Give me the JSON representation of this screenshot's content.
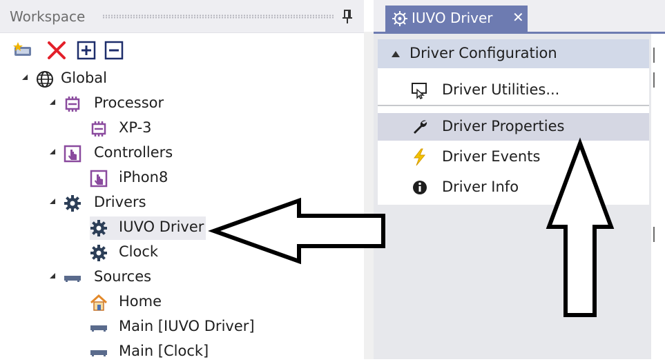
{
  "workspace": {
    "title": "Workspace",
    "pin_icon": "pin-icon",
    "toolbar": [
      {
        "name": "add-item-button",
        "icon": "add-item-icon"
      },
      {
        "name": "delete-button",
        "icon": "red-x-icon"
      },
      {
        "name": "expand-all-button",
        "icon": "plus-box-icon"
      },
      {
        "name": "collapse-all-button",
        "icon": "minus-box-icon"
      }
    ],
    "tree": {
      "global": "Global",
      "processor": "Processor",
      "processor_child": "XP-3",
      "controllers": "Controllers",
      "controller_child": "iPhon8",
      "drivers": "Drivers",
      "driver_1": "IUVO Driver",
      "driver_2": "Clock",
      "sources": "Sources",
      "source_1": "Home",
      "source_2": "Main [IUVO Driver]",
      "source_3": "Main [Clock]"
    }
  },
  "document": {
    "tab": {
      "label": "IUVO Driver",
      "close": "✕",
      "icon": "gear-icon"
    },
    "config": {
      "title": "Driver Configuration",
      "items": [
        {
          "label": "Driver Utilities...",
          "icon": "monitor-cursor-icon"
        },
        {
          "label": "Driver Properties",
          "icon": "wrench-icon"
        },
        {
          "label": "Driver Events",
          "icon": "lightning-icon"
        },
        {
          "label": "Driver Info",
          "icon": "info-icon"
        }
      ]
    }
  },
  "colors": {
    "tab_active": "#6d7bb1",
    "header_bg": "#d2d9e8",
    "item_hover": "#d5d7e3",
    "purple_icon": "#8a4a9e",
    "gear_dark": "#2c3e57"
  },
  "annotations": [
    "left-pointing-arrow",
    "up-pointing-arrow"
  ]
}
